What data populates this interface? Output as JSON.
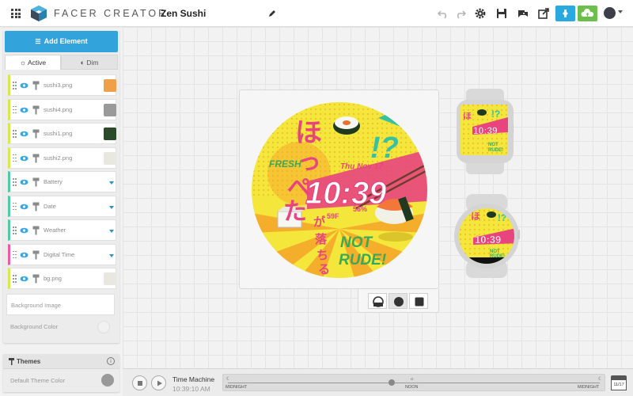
{
  "header": {
    "brand": "FACER CREATOR",
    "project_title": "Zen Sushi"
  },
  "left_panel": {
    "add_element_label": "Add Element",
    "tabs": [
      {
        "label": "Active",
        "selected": true
      },
      {
        "label": "Dim",
        "selected": false
      }
    ],
    "layers": [
      {
        "name": "sushi3.png",
        "kind": "image",
        "stripe": "#d9e84c"
      },
      {
        "name": "sushi4.png",
        "kind": "image",
        "stripe": "#d9e84c"
      },
      {
        "name": "sushi1.png",
        "kind": "image",
        "stripe": "#d9e84c"
      },
      {
        "name": "sushi2.png",
        "kind": "image",
        "stripe": "#d9e84c"
      },
      {
        "name": "Battery",
        "kind": "group",
        "stripe": "#4fc9a6"
      },
      {
        "name": "Date",
        "kind": "group",
        "stripe": "#4fc9a6"
      },
      {
        "name": "Weather",
        "kind": "group",
        "stripe": "#4fc9a6"
      },
      {
        "name": "Digital Time",
        "kind": "group",
        "stripe": "#ee5aa0"
      },
      {
        "name": "bg.png",
        "kind": "image",
        "stripe": "#d9e84c"
      }
    ],
    "background_image_label": "Background Image",
    "background_color_label": "Background Color"
  },
  "themes": {
    "title": "Themes",
    "info_icon": "i",
    "default_label": "Default Theme Color",
    "default_color": "#999999"
  },
  "watch_face": {
    "time": "10:39",
    "date": "Thu Nov 17",
    "weather": "59F",
    "battery": "56%",
    "texts": {
      "fresh": "FRESH",
      "not": "NOT",
      "rude": "RUDE!",
      "exclaim": "!?",
      "jp_top": "ほっぺた",
      "jp_bottom": "が落ちる"
    },
    "colors": {
      "yellow": "#f4e63a",
      "orange": "#f4a52b",
      "pink": "#e8457f",
      "teal": "#38c1a0",
      "green_text": "#3aa856"
    }
  },
  "time_machine": {
    "title": "Time Machine",
    "time": "10:39:10 AM",
    "labels": {
      "left": "MIDNIGHT",
      "center": "NOON",
      "right": "MIDNIGHT"
    },
    "calendar_date": "11/17"
  }
}
